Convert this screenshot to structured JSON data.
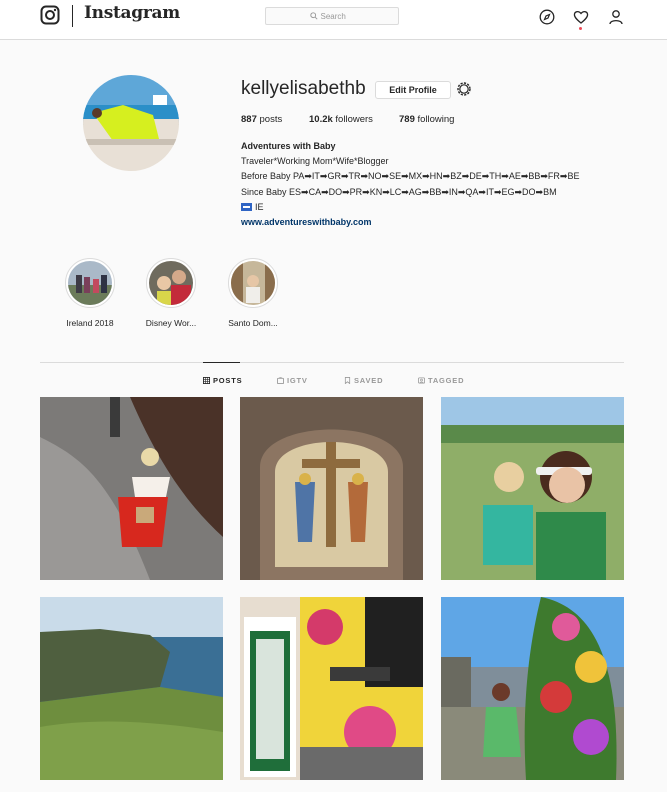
{
  "nav": {
    "brand": "Instagram",
    "search_placeholder": "Search",
    "icons": [
      "instagram-logo-icon",
      "search-icon",
      "compass-icon",
      "heart-icon",
      "person-icon"
    ]
  },
  "profile": {
    "username": "kellyelisabethb",
    "edit_label": "Edit Profile",
    "posts_count": "887",
    "posts_label": "posts",
    "followers_count": "10.2k",
    "followers_label": "followers",
    "following_count": "789",
    "following_label": "following",
    "bio_name": "Adventures with Baby",
    "bio_line1": "Traveler*Working Mom*Wife*Blogger",
    "bio_line2": "Before Baby PA➡IT➡GR➡TR➡NO➡SE➡MX➡HN➡BZ➡DE➡TH➡AE➡BB➡FR➡BE",
    "bio_line3": "Since Baby ES➡CA➡DO➡PR➡KN➡LC➡AG➡BB➡IN➡QA➡IT➡EG➡DO➡BM",
    "bio_line4": "IE",
    "website": "www.adventureswithbaby.com"
  },
  "highlights": [
    {
      "label": "Ireland 2018"
    },
    {
      "label": "Disney Wor..."
    },
    {
      "label": "Santo Dom..."
    }
  ],
  "tabs": [
    {
      "label": "POSTS",
      "active": true,
      "icon": "grid-icon"
    },
    {
      "label": "IGTV",
      "active": false,
      "icon": "tv-icon"
    },
    {
      "label": "SAVED",
      "active": false,
      "icon": "bookmark-icon"
    },
    {
      "label": "TAGGED",
      "active": false,
      "icon": "tag-icon"
    }
  ],
  "colors": {
    "accent_link": "#003569",
    "notification_dot": "#ed4956",
    "border": "#dbdbdb"
  }
}
